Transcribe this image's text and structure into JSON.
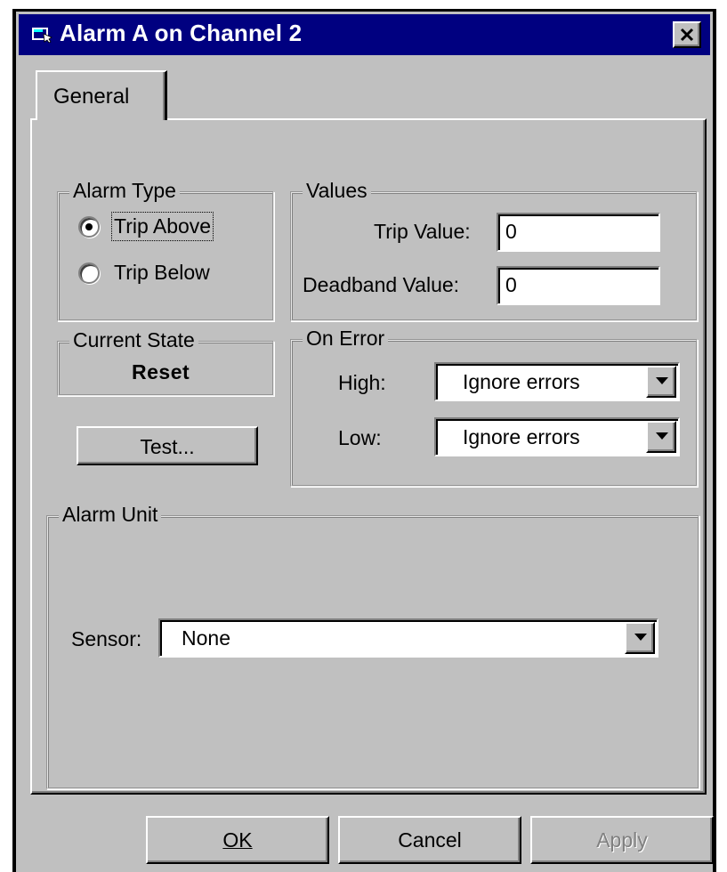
{
  "window": {
    "title": "Alarm A on Channel 2",
    "close_glyph": "✕"
  },
  "tabs": [
    {
      "label": "General"
    }
  ],
  "alarm_type": {
    "legend": "Alarm Type",
    "options": [
      {
        "label": "Trip Above",
        "selected": true
      },
      {
        "label": "Trip Below",
        "selected": false
      }
    ]
  },
  "values": {
    "legend": "Values",
    "trip_value_label": "Trip Value:",
    "trip_value": "0",
    "deadband_value_label": "Deadband Value:",
    "deadband_value": "0"
  },
  "current_state": {
    "legend": "Current State",
    "value": "Reset"
  },
  "test_button": "Test...",
  "on_error": {
    "legend": "On Error",
    "high_label": "High:",
    "high_value": "Ignore errors",
    "low_label": "Low:",
    "low_value": "Ignore errors"
  },
  "alarm_unit": {
    "legend": "Alarm Unit",
    "sensor_label": "Sensor:",
    "sensor_value": "None"
  },
  "buttons": {
    "ok": "OK",
    "cancel": "Cancel",
    "apply": "Apply"
  },
  "colors": {
    "titlebar": "#000080",
    "face": "#c0c0c0"
  }
}
